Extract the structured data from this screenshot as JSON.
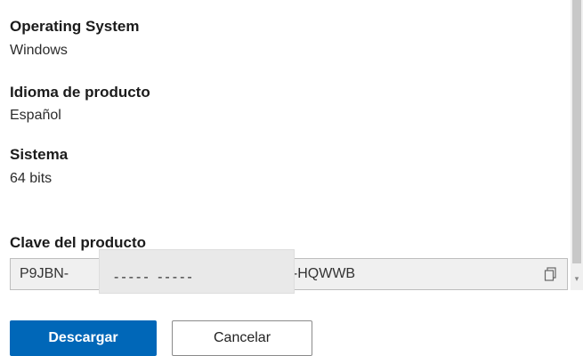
{
  "fields": {
    "os": {
      "label": "Operating System",
      "value": "Windows"
    },
    "language": {
      "label": "Idioma de producto",
      "value": "Español"
    },
    "system": {
      "label": "Sistema",
      "value": "64 bits"
    }
  },
  "product_key": {
    "label": "Clave del producto",
    "prefix": "P9JBN-",
    "redaction_mask": "----- -----",
    "suffix": "4-HQWWB",
    "copy_icon": "copy-icon"
  },
  "buttons": {
    "download": "Descargar",
    "cancel": "Cancelar"
  },
  "colors": {
    "primary": "#0067b8",
    "field_bg": "#f0f0f0"
  }
}
